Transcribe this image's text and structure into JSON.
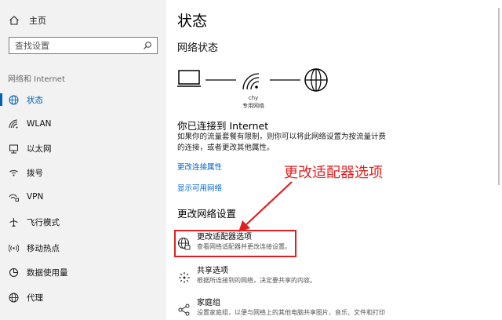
{
  "sidebar": {
    "home_label": "主页",
    "search_placeholder": "查找设置",
    "section_label": "网络和 Internet",
    "items": [
      {
        "label": "状态"
      },
      {
        "label": "WLAN"
      },
      {
        "label": "以太网"
      },
      {
        "label": "拨号"
      },
      {
        "label": "VPN"
      },
      {
        "label": "飞行模式"
      },
      {
        "label": "移动热点"
      },
      {
        "label": "数据使用量"
      },
      {
        "label": "代理"
      }
    ]
  },
  "main": {
    "title": "状态",
    "network_status_heading": "网络状态",
    "network_name_line1": "chy",
    "network_name_line2": "专用网络",
    "connected_heading": "你已连接到 Internet",
    "connected_desc": "如果你的流量套餐有限制，则你可以将此网络设置为按流量计费的连接，或者更改其他属性。",
    "link_change_props": "更改连接属性",
    "link_show_networks": "显示可用网络",
    "change_settings_heading": "更改网络设置",
    "options": [
      {
        "title": "更改适配器选项",
        "desc": "查看网络适配器并更改连接设置。"
      },
      {
        "title": "共享选项",
        "desc": "根据所连接到的网络，决定要共享的内容。"
      },
      {
        "title": "家庭组",
        "desc": "设置家庭组，以便与网络上的其他电脑共享图片、音乐、文件和打印"
      }
    ]
  },
  "annotation": {
    "text": "更改适配器选项",
    "color": "#e02020"
  },
  "colors": {
    "accent": "#0063b1",
    "link": "#0066cc",
    "sidebar_bg": "#f2f2f2"
  }
}
